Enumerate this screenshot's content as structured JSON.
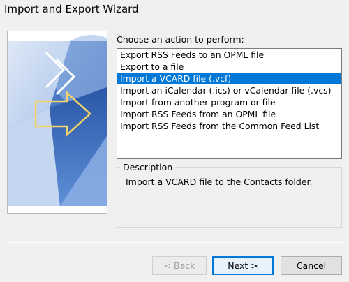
{
  "window": {
    "title": "Import and Export Wizard"
  },
  "wizard": {
    "prompt": "Choose an action to perform:",
    "actions": [
      "Export RSS Feeds to an OPML file",
      "Export to a file",
      "Import a VCARD file (.vcf)",
      "Import an iCalendar (.ics) or vCalendar file (.vcs)",
      "Import from another program or file",
      "Import RSS Feeds from an OPML file",
      "Import RSS Feeds from the Common Feed List"
    ],
    "selected_action": "Import a VCARD file (.vcf)",
    "description_label": "Description",
    "description_text": "Import a VCARD file to the Contacts folder."
  },
  "buttons": {
    "back_label": "< Back",
    "next_label": "Next >",
    "cancel_label": "Cancel"
  },
  "colors": {
    "selection": "#0078d7",
    "background": "#f0f0f0",
    "art_blue": "#2e5ba8"
  },
  "icons": [
    "wizard-banner-arrows-image"
  ]
}
